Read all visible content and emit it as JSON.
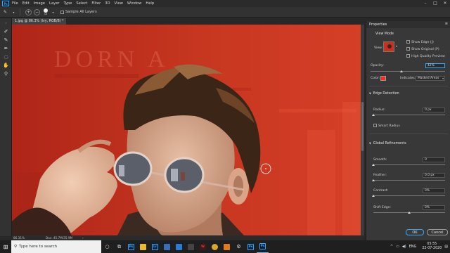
{
  "menu": {
    "app_icon": "Ps",
    "items": [
      "File",
      "Edit",
      "Image",
      "Layer",
      "Type",
      "Select",
      "Filter",
      "3D",
      "View",
      "Window",
      "Help"
    ]
  },
  "options_bar": {
    "brush_size": "10",
    "sample_all_layers": "Sample All Layers"
  },
  "document": {
    "tab_title": "1.jpg @ 86.3% (Ivy, RGB/8) *",
    "backdrop_text": "DORN A"
  },
  "status": {
    "zoom": "86.31%",
    "doc_size": "Doc: 45.7M/35.9M"
  },
  "properties": {
    "title": "Properties",
    "view_mode_label": "View Mode",
    "view_label": "View:",
    "show_edge": "Show Edge (J)",
    "show_original": "Show Original (P)",
    "high_quality_preview": "High Quality Preview",
    "opacity_label": "Opacity:",
    "opacity_value": "42%",
    "color_label": "Color:",
    "indicates_label": "Indicates:",
    "indicates_value": "Masked Areas",
    "edge_detection": "Edge Detection",
    "radius_label": "Radius:",
    "radius_value": "0 px",
    "smart_radius": "Smart Radius",
    "global_refinements": "Global Refinements",
    "smooth_label": "Smooth:",
    "smooth_value": "0",
    "feather_label": "Feather:",
    "feather_value": "0.0 px",
    "contrast_label": "Contrast:",
    "contrast_value": "0%",
    "shift_edge_label": "Shift Edge:",
    "shift_edge_value": "0%",
    "ok_label": "OK",
    "cancel_label": "Cancel"
  },
  "sliders": {
    "opacity_level": 0.42,
    "radius_level": 0.0,
    "smooth_level": 0.0,
    "feather_level": 0.0,
    "contrast_level": 0.0,
    "shift_edge_level": 0.5
  },
  "taskbar": {
    "search_placeholder": "Type here to search",
    "clock_time": "05:55",
    "clock_date": "22-07-2020",
    "language": "ENG",
    "app_icons": [
      "Ps",
      "Lr",
      "Ps",
      "Ps"
    ]
  },
  "colors": {
    "overlay_red": "#c9301f",
    "accent_blue": "#31a8ff",
    "overlay_swatch": "#ff2a1a"
  }
}
